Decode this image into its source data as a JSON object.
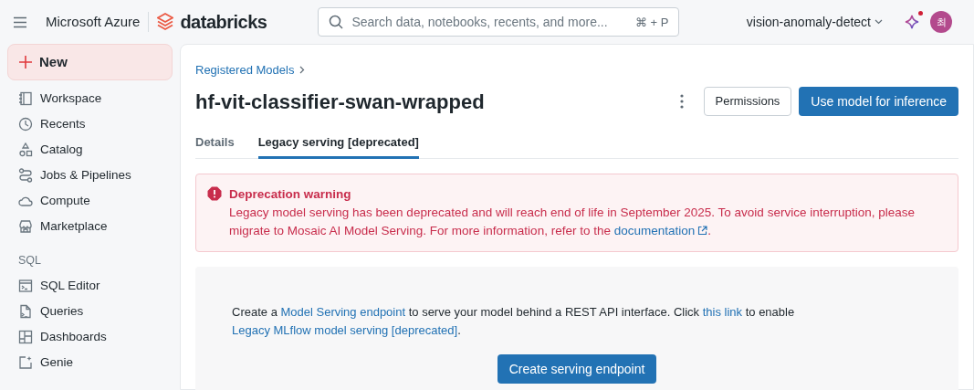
{
  "topbar": {
    "brand": "Microsoft Azure",
    "product": "databricks",
    "search": {
      "placeholder": "Search data, notebooks, recents, and more...",
      "shortcut": "⌘ + P"
    },
    "workspace": "vision-anomaly-detect",
    "assistant_notification": true,
    "avatar": "최"
  },
  "sidebar": {
    "new_button": "New",
    "items": [
      {
        "label": "Workspace"
      },
      {
        "label": "Recents"
      },
      {
        "label": "Catalog"
      },
      {
        "label": "Jobs & Pipelines"
      },
      {
        "label": "Compute"
      },
      {
        "label": "Marketplace"
      }
    ],
    "sections": [
      {
        "title": "SQL",
        "items": [
          {
            "label": "SQL Editor"
          },
          {
            "label": "Queries"
          },
          {
            "label": "Dashboards"
          },
          {
            "label": "Genie"
          }
        ]
      }
    ]
  },
  "breadcrumb": "Registered Models",
  "title": "hf-vit-classifier-swan-wrapped",
  "actions": {
    "secondary": "Permissions",
    "primary": "Use model for inference"
  },
  "tabs": [
    {
      "label": "Details",
      "selected": false
    },
    {
      "label": "Legacy serving [deprecated]",
      "selected": true
    }
  ],
  "alert": {
    "title": "Deprecation warning",
    "message": "Legacy model serving has been deprecated and will reach end of life in September 2025. To avoid service interruption, please migrate to Mosaic AI Model Serving. For more information, refer to the ",
    "link": "documentation",
    "end": "."
  },
  "panel": {
    "segments": [
      {
        "text": "Create a ",
        "link": false
      },
      {
        "text": "Model Serving endpoint",
        "link": true
      },
      {
        "text": " to serve your model behind a REST API interface. Click ",
        "link": false
      },
      {
        "text": "this link",
        "link": true
      },
      {
        "text": " to enable ",
        "link": false
      },
      {
        "text": "Legacy MLflow model serving [deprecated]",
        "link": true
      },
      {
        "text": ".",
        "link": false
      }
    ],
    "button": "Create serving endpoint"
  }
}
